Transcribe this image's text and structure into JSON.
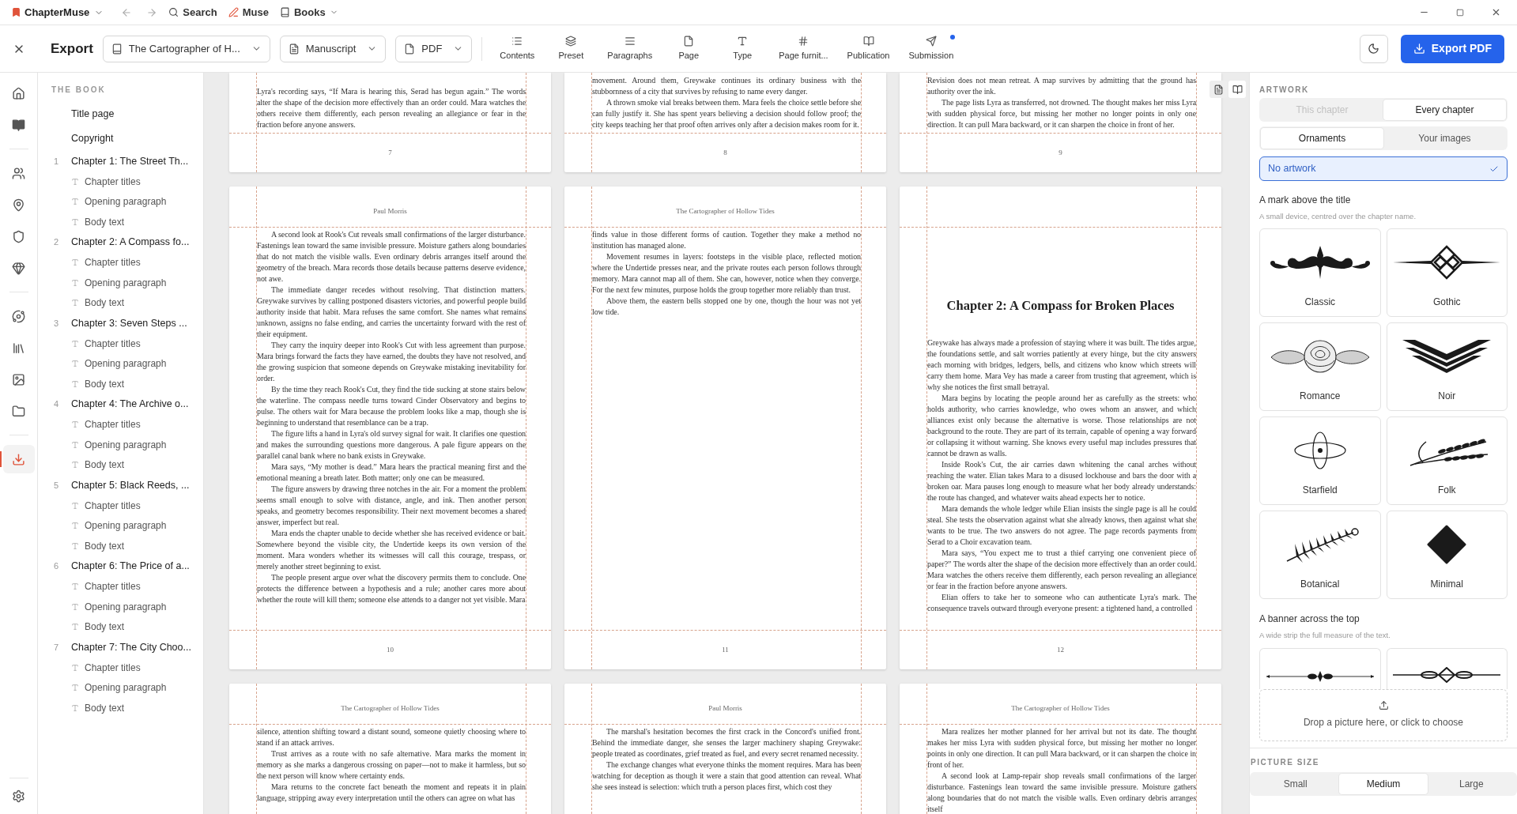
{
  "titlebar": {
    "app_name": "ChapterMuse",
    "nav": [
      {
        "label": "Search"
      },
      {
        "label": "Muse"
      },
      {
        "label": "Books"
      }
    ]
  },
  "toolbar": {
    "title": "Export",
    "dropdowns": [
      {
        "label": "The Cartographer of H..."
      },
      {
        "label": "Manuscript"
      },
      {
        "label": "PDF"
      }
    ],
    "tools": [
      {
        "label": "Contents",
        "notification": false
      },
      {
        "label": "Preset",
        "notification": false
      },
      {
        "label": "Paragraphs",
        "notification": false
      },
      {
        "label": "Page",
        "notification": false
      },
      {
        "label": "Type",
        "notification": false
      },
      {
        "label": "Page furnit...",
        "notification": false
      },
      {
        "label": "Publication",
        "notification": false
      },
      {
        "label": "Submission",
        "notification": true
      }
    ],
    "export_button": "Export PDF"
  },
  "nav_rail": {
    "groups": [
      {
        "items": [
          {
            "selected": false
          },
          {
            "selected": false
          }
        ]
      },
      {
        "items": [
          {
            "selected": false
          },
          {
            "selected": false
          },
          {
            "selected": false
          },
          {
            "selected": false
          }
        ]
      },
      {
        "items": [
          {
            "selected": false
          },
          {
            "selected": false
          },
          {
            "selected": false
          },
          {
            "selected": false
          }
        ]
      },
      {
        "items": [
          {
            "selected": true
          }
        ]
      }
    ]
  },
  "sidebar": {
    "heading": "THE BOOK",
    "front_matter": [
      "Title page",
      "Copyright"
    ],
    "chapters": [
      {
        "number": "1",
        "title": "Chapter 1: The Street Th...",
        "children": [
          "Chapter titles",
          "Opening paragraph",
          "Body text"
        ]
      },
      {
        "number": "2",
        "title": "Chapter 2: A Compass fo...",
        "children": [
          "Chapter titles",
          "Opening paragraph",
          "Body text"
        ]
      },
      {
        "number": "3",
        "title": "Chapter 3: Seven Steps ...",
        "children": [
          "Chapter titles",
          "Opening paragraph",
          "Body text"
        ]
      },
      {
        "number": "4",
        "title": "Chapter 4: The Archive o...",
        "children": [
          "Chapter titles",
          "Opening paragraph",
          "Body text"
        ]
      },
      {
        "number": "5",
        "title": "Chapter 5: Black Reeds, ...",
        "children": [
          "Chapter titles",
          "Opening paragraph",
          "Body text"
        ]
      },
      {
        "number": "6",
        "title": "Chapter 6: The Price of a...",
        "children": [
          "Chapter titles",
          "Opening paragraph",
          "Body text"
        ]
      },
      {
        "number": "7",
        "title": "Chapter 7: The City Choo...",
        "children": [
          "Chapter titles",
          "Opening paragraph",
          "Body text"
        ]
      }
    ]
  },
  "view_modes": [
    {
      "selected": true
    },
    {
      "selected": false
    }
  ],
  "page_rows": [
    {
      "kind": "cut_top",
      "pages": [
        {
          "folio": "7",
          "paragraphs": [
            {
              "indent": false,
              "text": "Lyra's recording says, “If Mara is hearing this, Serad has begun again.” The words alter the shape of the decision more effectively than an order could. Mara watches the others receive them differently, each person revealing an allegiance or fear in the fraction before anyone answers."
            }
          ]
        },
        {
          "folio": "8",
          "paragraphs": [
            {
              "indent": false,
              "text": "movement. Around them, Greywake continues its ordinary business with the stubbornness of a city that survives by refusing to name every danger."
            },
            {
              "indent": true,
              "text": "A thrown smoke vial breaks between them. Mara feels the choice settle before she can fully justify it. She has spent years believing a decision should follow proof; the city keeps teaching her that proof often arrives only after a decision makes room for it."
            }
          ]
        },
        {
          "folio": "9",
          "paragraphs": [
            {
              "indent": false,
              "text": "Revision does not mean retreat. A map survives by admitting that the ground has authority over the ink."
            },
            {
              "indent": true,
              "text": "The page lists Lyra as transferred, not drowned. The thought makes her miss Lyra with sudden physical force, but missing her mother no longer points in only one direction. It can pull Mara backward, or it can sharpen the choice in front of her."
            }
          ]
        }
      ]
    },
    {
      "kind": "whole",
      "pages": [
        {
          "running_head": "Paul Morris",
          "folio": "10",
          "paragraphs": [
            {
              "indent": true,
              "text": "A second look at Rook's Cut reveals small confirmations of the larger disturbance. Fastenings lean toward the same invisible pressure. Moisture gathers along boundaries that do not match the visible walls. Even ordinary debris arranges itself around the geometry of the breach. Mara records those details because patterns deserve evidence, not awe."
            },
            {
              "indent": true,
              "text": "The immediate danger recedes without resolving. That distinction matters. Greywake survives by calling postponed disasters victories, and powerful people build authority inside that habit. Mara refuses the same comfort. She names what remains unknown, assigns no false ending, and carries the uncertainty forward with the rest of their equipment."
            },
            {
              "indent": true,
              "text": "They carry the inquiry deeper into Rook's Cut with less agreement than purpose. Mara brings forward the facts they have earned, the doubts they have not resolved, and the growing suspicion that someone depends on Greywake mistaking inevitability for order."
            },
            {
              "indent": true,
              "text": "By the time they reach Rook's Cut, they find the tide sucking at stone stairs below the waterline. The compass needle turns toward Cinder Observatory and begins to pulse. The others wait for Mara because the problem looks like a map, though she is beginning to understand that resemblance can be a trap."
            },
            {
              "indent": true,
              "text": "The figure lifts a hand in Lyra's old survey signal for wait. It clarifies one question and makes the surrounding questions more dangerous. A pale figure appears on the parallel canal bank where no bank exists in Greywake."
            },
            {
              "indent": true,
              "text": "Mara says, “My mother is dead.” Mara hears the practical meaning first and the emotional meaning a breath later. Both matter; only one can be measured."
            },
            {
              "indent": true,
              "text": "The figure answers by drawing three notches in the air. For a moment the problem seems small enough to solve with distance, angle, and ink. Then another person speaks, and geometry becomes responsibility. Their next movement becomes a shared answer, imperfect but real."
            },
            {
              "indent": true,
              "text": "Mara ends the chapter unable to decide whether she has received evidence or bait. Somewhere beyond the visible city, the Undertide keeps its own version of the moment. Mara wonders whether its witnesses will call this courage, trespass, or merely another street beginning to exist."
            },
            {
              "indent": true,
              "text": "The people present argue over what the discovery permits them to conclude. One protects the difference between a hypothesis and a rule; another cares more about whether the route will kill them; someone else attends to a danger not yet visible. Mara"
            }
          ]
        },
        {
          "running_head": "The Cartographer of Hollow Tides",
          "folio": "11",
          "paragraphs": [
            {
              "indent": false,
              "text": "finds value in those different forms of caution. Together they make a method no institution has managed alone."
            },
            {
              "indent": true,
              "text": "Movement resumes in layers: footsteps in the visible place, reflected motion where the Undertide presses near, and the private routes each person follows through memory. Mara cannot map all of them. She can, however, notice when they converge. For the next few minutes, purpose holds the group together more reliably than trust."
            },
            {
              "indent": true,
              "text": "Above them, the eastern bells stopped one by one, though the hour was not yet low tide."
            }
          ]
        },
        {
          "chapter_title": "Chapter 2: A Compass for Broken Places",
          "folio": "12",
          "paragraphs": [
            {
              "indent": false,
              "text": "Greywake has always made a profession of staying where it was built. The tides argue, the foundations settle, and salt worries patiently at every hinge, but the city answers each morning with bridges, ledgers, bells, and citizens who know which streets will carry them home. Mara Vey has made a career from trusting that agreement, which is why she notices the first small betrayal."
            },
            {
              "indent": true,
              "text": "Mara begins by locating the people around her as carefully as the streets: who holds authority, who carries knowledge, who owes whom an answer, and which alliances exist only because the alternative is worse. Those relationships are not background to the route. They are part of its terrain, capable of opening a way forward or collapsing it without warning. She knows every useful map includes pressures that cannot be drawn as walls."
            },
            {
              "indent": true,
              "text": "Inside Rook's Cut, the air carries dawn whitening the canal arches without reaching the water. Elian takes Mara to a disused lockhouse and bars the door with a broken oar. Mara pauses long enough to measure what her body already understands: the route has changed, and whatever waits ahead expects her to notice."
            },
            {
              "indent": true,
              "text": "Mara demands the whole ledger while Elian insists the single page is all he could steal. She tests the observation against what she already knows, then against what she wants to be true. The two answers do not agree. The page records payments from Serad to a Choir excavation team."
            },
            {
              "indent": true,
              "text": "Mara says, “You expect me to trust a thief carrying one convenient piece of paper?” The words alter the shape of the decision more effectively than an order could. Mara watches the others receive them differently, each person revealing an allegiance or fear in the fraction before anyone answers."
            },
            {
              "indent": true,
              "text": "Elian offers to take her to someone who can authenticate Lyra's mark. The consequence travels outward through everyone present: a tightened hand, a controlled"
            }
          ]
        }
      ]
    },
    {
      "kind": "cut_bottom",
      "pages": [
        {
          "running_head": "The Cartographer of Hollow Tides",
          "paragraphs": [
            {
              "indent": false,
              "text": "silence, attention shifting toward a distant sound, someone quietly choosing where to stand if an attack arrives."
            },
            {
              "indent": true,
              "text": "Trust arrives as a route with no safe alternative. Mara marks the moment in memory as she marks a dangerous crossing on paper—not to make it harmless, but so the next person will know where certainty ends."
            },
            {
              "indent": true,
              "text": "Mara returns to the concrete fact beneath the moment and repeats it in plain language, stripping away every interpretation until the others can agree on what has"
            }
          ]
        },
        {
          "running_head": "Paul Morris",
          "paragraphs": [
            {
              "indent": true,
              "text": "The marshal's hesitation becomes the first crack in the Concord's unified front. Behind the immediate danger, she senses the larger machinery shaping Greywake: people treated as coordinates, grief treated as fuel, and every secret renamed necessity."
            },
            {
              "indent": true,
              "text": "The exchange changes what everyone thinks the moment requires. Mara has been watching for deception as though it were a stain that good attention can reveal. What she sees instead is selection: which truth a person places first, which cost they"
            }
          ]
        },
        {
          "running_head": "The Cartographer of Hollow Tides",
          "paragraphs": [
            {
              "indent": true,
              "text": "Mara realizes her mother planned for her arrival but not its date. The thought makes her miss Lyra with sudden physical force, but missing her mother no longer points in only one direction. It can pull Mara backward, or it can sharpen the choice in front of her."
            },
            {
              "indent": true,
              "text": "A second look at Lamp-repair shop reveals small confirmations of the larger disturbance. Fastenings lean toward the same invisible pressure. Moisture gathers along boundaries that do not match the visible walls. Even ordinary debris arranges itself"
            }
          ]
        }
      ]
    }
  ],
  "artwork_panel": {
    "heading": "ARTWORK",
    "scope": [
      {
        "label": "This chapter",
        "selected": false,
        "disabled": true
      },
      {
        "label": "Every chapter",
        "selected": true,
        "disabled": false
      }
    ],
    "source": [
      {
        "label": "Ornaments",
        "selected": true
      },
      {
        "label": "Your images",
        "selected": false
      }
    ],
    "no_artwork": {
      "label": "No artwork",
      "selected": true
    },
    "mark_section": {
      "title": "A mark above the title",
      "subtitle": "A small device, centred over the chapter name.",
      "ornaments": [
        {
          "label": "Classic",
          "selected": false
        },
        {
          "label": "Gothic",
          "selected": false
        },
        {
          "label": "Romance",
          "selected": false
        },
        {
          "label": "Noir",
          "selected": false
        },
        {
          "label": "Starfield",
          "selected": false
        },
        {
          "label": "Folk",
          "selected": false
        },
        {
          "label": "Botanical",
          "selected": false
        },
        {
          "label": "Minimal",
          "selected": false
        }
      ]
    },
    "banner_section": {
      "title": "A banner across the top",
      "subtitle": "A wide strip the full measure of the text.",
      "banners": [
        {
          "selected": false
        },
        {
          "selected": false
        }
      ]
    },
    "dropzone": "Drop a picture here, or click to choose",
    "picture_size": {
      "heading": "PICTURE SIZE",
      "options": [
        {
          "label": "Small",
          "selected": false
        },
        {
          "label": "Medium",
          "selected": true
        },
        {
          "label": "Large",
          "selected": false
        }
      ]
    }
  }
}
